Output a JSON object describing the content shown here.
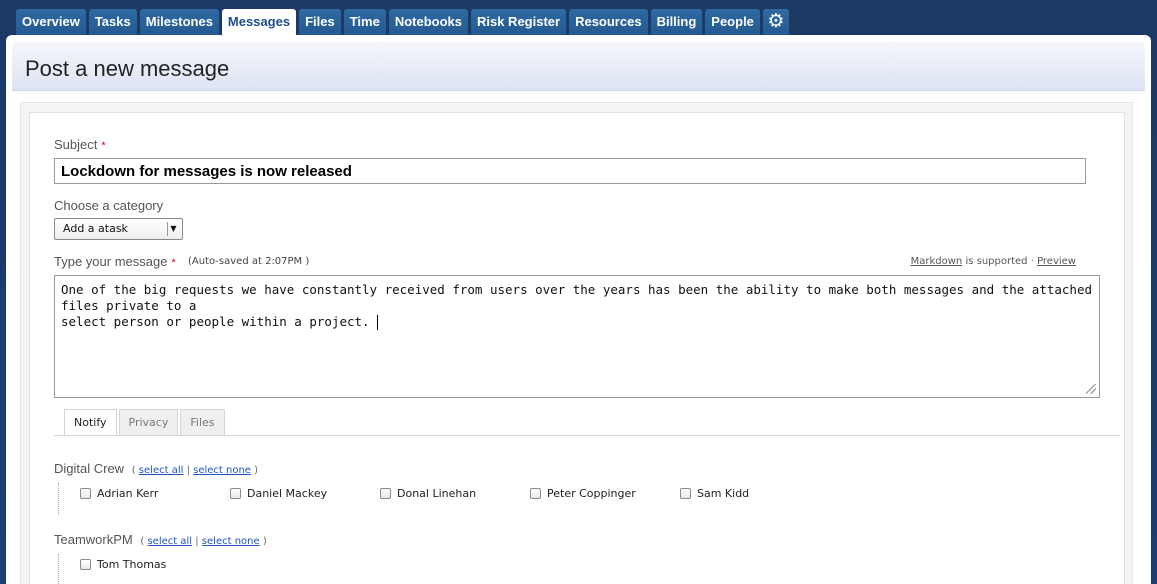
{
  "tabs": [
    {
      "label": "Overview",
      "active": false
    },
    {
      "label": "Tasks",
      "active": false
    },
    {
      "label": "Milestones",
      "active": false
    },
    {
      "label": "Messages",
      "active": true
    },
    {
      "label": "Files",
      "active": false
    },
    {
      "label": "Time",
      "active": false
    },
    {
      "label": "Notebooks",
      "active": false
    },
    {
      "label": "Risk Register",
      "active": false
    },
    {
      "label": "Resources",
      "active": false
    },
    {
      "label": "Billing",
      "active": false
    },
    {
      "label": "People",
      "active": false
    }
  ],
  "settings_icon": "gear-icon",
  "page_title": "Post a new message",
  "form": {
    "subject_label": "Subject",
    "required_mark": "*",
    "subject_value": "Lockdown for messages is now released",
    "category_label": "Choose a category",
    "category_selected": "Add a atask",
    "message_label": "Type your message",
    "autosave_text": "(Auto-saved at 2:07PM )",
    "markdown_link": "Markdown",
    "markdown_supported": "is supported ·",
    "preview_link": "Preview",
    "message_line1": "One of the big requests we have constantly received from users over the years has been the ability to make both messages and the attached files private to a",
    "message_line2": "select person or people within a project."
  },
  "subtabs": [
    {
      "label": "Notify",
      "active": true
    },
    {
      "label": "Privacy",
      "active": false
    },
    {
      "label": "Files",
      "active": false
    }
  ],
  "groups": [
    {
      "name": "Digital Crew",
      "open_paren": "(",
      "select_all": "select all",
      "separator": "|",
      "select_none": "select none",
      "close_paren": ")",
      "people": [
        "Adrian Kerr",
        "Daniel Mackey",
        "Donal Linehan",
        "Peter Coppinger",
        "Sam Kidd"
      ]
    },
    {
      "name": "TeamworkPM",
      "open_paren": "(",
      "select_all": "select all",
      "separator": "|",
      "select_none": "select none",
      "close_paren": ")",
      "people": [
        "Tom Thomas"
      ]
    }
  ]
}
